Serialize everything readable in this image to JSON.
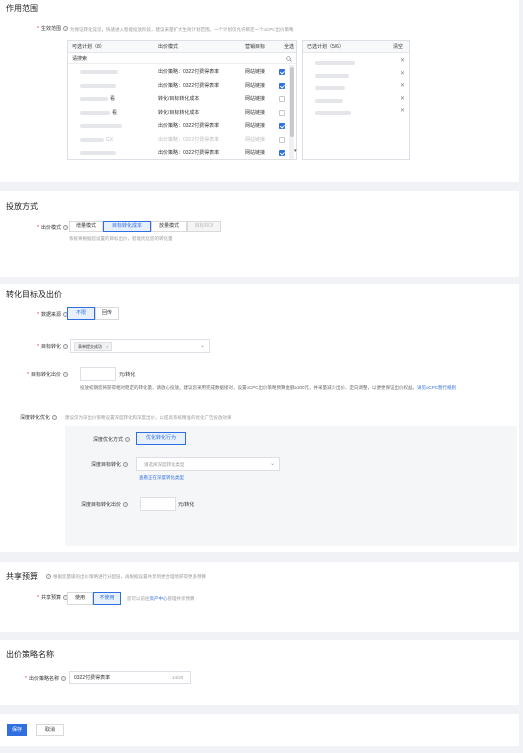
{
  "scope": {
    "title": "作用范围",
    "effect_plan_label": "生效范围",
    "effect_plan_hint": "为保证转化竞见，快速进入智能投放阶段，建议采量扩大生效计划范围。一个计划仅允许绑定一个oCPC出价策略",
    "available": {
      "header": "可选计划（8）",
      "col_mode": "出价模式",
      "col_target": "营销目标",
      "select_all": "全选",
      "search_placeholder": "请搜索",
      "rows": [
        {
          "mode": "出价策略：0322付费得表率",
          "target": "网站链接",
          "checked": true,
          "dim": false
        },
        {
          "mode": "出价策略：0322付费得表率",
          "target": "网站链接",
          "checked": true,
          "dim": false
        },
        {
          "mode": "转化/目标转化成本",
          "target": "网站链接",
          "checked": false,
          "dim": false
        },
        {
          "mode": "转化/目标转化成本",
          "target": "网站链接",
          "checked": false,
          "dim": false
        },
        {
          "mode": "出价策略：0322付费得表率",
          "target": "网站链接",
          "checked": true,
          "dim": false
        },
        {
          "mode": "出价策略：0322付费得表率",
          "target": "网站链接",
          "checked": false,
          "dim": true
        },
        {
          "mode": "出价策略：0322付费得表率",
          "target": "网站链接",
          "checked": true,
          "dim": false
        }
      ],
      "row_suffixes": [
        "",
        "",
        "看",
        "看",
        "",
        "GX",
        ""
      ]
    },
    "selected": {
      "header": "已选计划（5/6）",
      "clear": "清空",
      "count": 5
    }
  },
  "delivery": {
    "title": "投放方式",
    "bid_mode_label": "出价模式",
    "options": [
      "增量模式",
      "目标转化成本",
      "放量模式",
      "目标ROI"
    ],
    "active_index": 1,
    "disabled_index": 3,
    "hint": "系统将根据您设置的目标出价，智能优化您的转化量"
  },
  "conversion": {
    "title": "转化目标及出价",
    "data_source_label": "数据来源",
    "data_source_options": [
      "不限",
      "回传"
    ],
    "target_label": "目标转化",
    "target_tag": "表单提交成功",
    "target_bid_label": "目标转化出价",
    "bid_unit": "元/转化",
    "bid_note": "投放初期您将获得相对稳定的转化量，请放心投放。建议您采用完成数据接对，设置oCPC出价策略预算金额≥300元，并采量减少出价、定向调整，以便更保证出价权益。",
    "bid_note_link": "详见oCPC暂行规则",
    "deep_label": "深度转化优化",
    "deep_hint": "建议仅为深出价策略设置深度转化和深度出价，以提高系统精准的优化广告投放效果",
    "deep_method_label": "深度优化方式",
    "deep_method_value": "优化转化行为",
    "deep_target_label": "深度目标转化",
    "deep_target_placeholder": "请选择深度转化类型",
    "deep_target_link": "查看正在深度转化类型",
    "deep_bid_label": "深度目标转化出价",
    "deep_bid_unit": "元/转化"
  },
  "budget": {
    "title": "共享预算",
    "hint": "根据您量级的出价策略进行分配层，再根据设置共享到更合理地获得更多预算",
    "label": "共享预算",
    "options": [
      "使用",
      "不使用"
    ],
    "active_index": 1,
    "note_prefix": "您可以前往",
    "note_link": "资产中心",
    "note_suffix": "管理共享预算"
  },
  "strategy": {
    "title": "出价策略名称",
    "label": "出价策略名称",
    "value": "0322付费得表率",
    "counter": "14/20"
  },
  "footer": {
    "save": "保存",
    "cancel": "取消"
  },
  "colors": {
    "accent": "#2f6fe0",
    "required": "#f5222d"
  }
}
